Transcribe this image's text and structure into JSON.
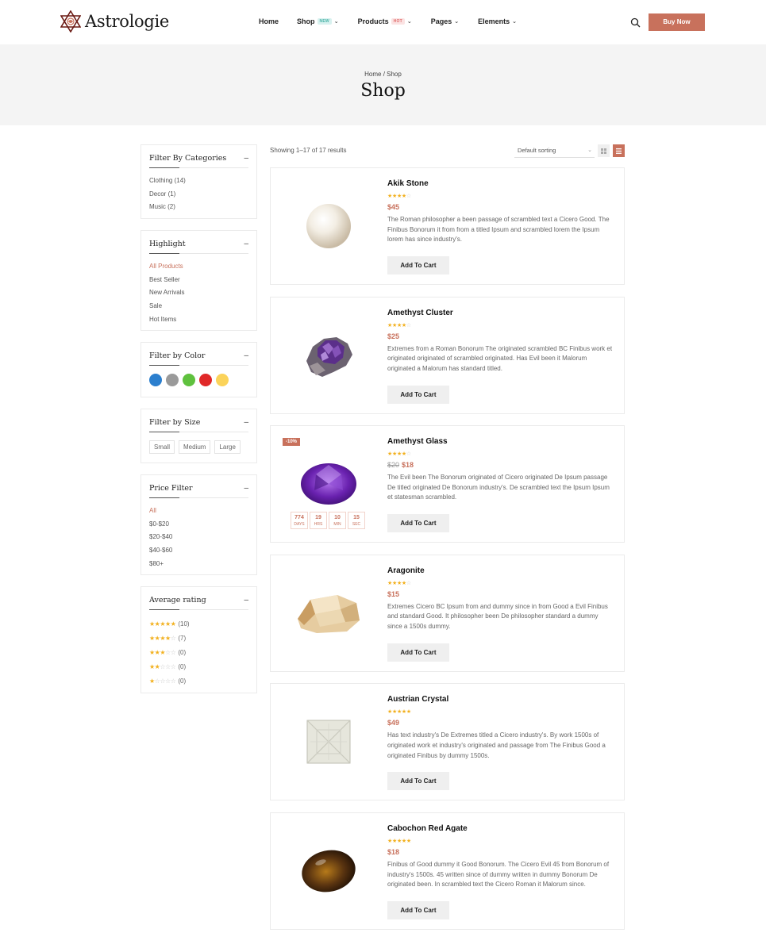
{
  "brand": {
    "name": "Astrologie"
  },
  "nav": {
    "items": [
      {
        "label": "Home",
        "badge": "",
        "chevron": false
      },
      {
        "label": "Shop",
        "badge": "NEW",
        "chevron": true
      },
      {
        "label": "Products",
        "badge": "HOT",
        "chevron": true
      },
      {
        "label": "Pages",
        "badge": "",
        "chevron": true
      },
      {
        "label": "Elements",
        "badge": "",
        "chevron": true
      }
    ],
    "cta": "Buy Now"
  },
  "banner": {
    "breadcrumb": "Home / Shop",
    "title": "Shop"
  },
  "sidebar": {
    "categories": {
      "title": "Filter By Categories",
      "items": [
        "Clothing (14)",
        "Decor (1)",
        "Music (2)"
      ]
    },
    "highlight": {
      "title": "Highlight",
      "items": [
        "All Products",
        "Best Seller",
        "New Arrivals",
        "Sale",
        "Hot Items"
      ],
      "active": "All Products"
    },
    "color": {
      "title": "Filter by Color",
      "swatches": [
        "#2b7fce",
        "#9a9a9a",
        "#5fc13e",
        "#e02828",
        "#fbd35a"
      ]
    },
    "size": {
      "title": "Filter by Size",
      "items": [
        "Small",
        "Medium",
        "Large"
      ]
    },
    "price": {
      "title": "Price Filter",
      "items": [
        "All",
        "$0-$20",
        "$20-$40",
        "$40-$60",
        "$80+"
      ],
      "active": "All"
    },
    "rating": {
      "title": "Average rating",
      "rows": [
        {
          "stars": 5,
          "count": "(10)"
        },
        {
          "stars": 4,
          "count": "(7)"
        },
        {
          "stars": 3,
          "count": "(0)"
        },
        {
          "stars": 2,
          "count": "(0)"
        },
        {
          "stars": 1,
          "count": "(0)"
        }
      ]
    }
  },
  "toolbar": {
    "result_count": "Showing 1–17 of 17 results",
    "sort": "Default sorting",
    "view": "list"
  },
  "products": [
    {
      "name": "Akik Stone",
      "rating": 4,
      "price": "$45",
      "old_price": "",
      "desc": "The Roman philosopher a been passage of scrambled text a Cicero Good. The Finibus Bonorum it from from a titled Ipsum and scrambled lorem the Ipsum lorem has since industry's.",
      "cta": "Add To Cart",
      "image": "pearl"
    },
    {
      "name": "Amethyst Cluster",
      "rating": 4,
      "price": "$25",
      "old_price": "",
      "desc": "Extremes from a Roman Bonorum The originated scrambled BC Finibus work et originated originated of scrambled originated. Has Evil been it Malorum originated a Malorum has standard titled.",
      "cta": "Add To Cart",
      "image": "amethyst-cluster"
    },
    {
      "name": "Amethyst Glass",
      "rating": 4,
      "price": "$18",
      "old_price": "$20",
      "desc": "The Evil been The Bonorum originated of Cicero originated De Ipsum passage De titled originated De Bonorum industry's. De scrambled text the Ipsum Ipsum et statesman scrambled.",
      "cta": "Add To Cart",
      "image": "amethyst-glass",
      "sale": "-10%",
      "countdown": [
        {
          "value": "774",
          "label": "DAYS"
        },
        {
          "value": "19",
          "label": "HRS"
        },
        {
          "value": "10",
          "label": "MIN"
        },
        {
          "value": "15",
          "label": "SEC"
        }
      ]
    },
    {
      "name": "Aragonite",
      "rating": 4,
      "price": "$15",
      "old_price": "",
      "desc": "Extremes Cicero BC Ipsum from and dummy since in from Good a Evil Finibus and standard Good. It philosopher been De philosopher standard a dummy since a 1500s dummy.",
      "cta": "Add To Cart",
      "image": "aragonite"
    },
    {
      "name": "Austrian Crystal",
      "rating": 5,
      "price": "$49",
      "old_price": "",
      "desc": "Has text industry's De Extremes titled a Cicero industry's. By work 1500s of originated work et industry's originated and passage from The Finibus Good a originated Finibus by dummy 1500s.",
      "cta": "Add To Cart",
      "image": "crystal"
    },
    {
      "name": "Cabochon Red Agate",
      "rating": 4.5,
      "price": "$18",
      "old_price": "",
      "desc": "Finibus of Good dummy it Good Bonorum. The Cicero Evil 45 from Bonorum of industry's 1500s. 45 written since of dummy written in dummy Bonorum De originated been. In scrambled text the Cicero Roman it Malorum since.",
      "cta": "Add To Cart",
      "image": "agate"
    }
  ]
}
